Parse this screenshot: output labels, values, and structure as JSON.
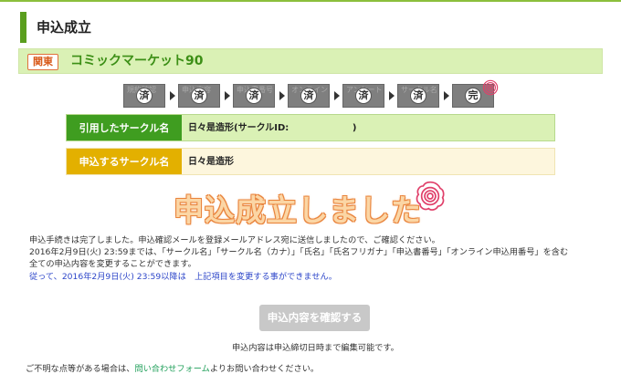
{
  "page": {
    "title": "申込成立"
  },
  "event": {
    "region": "関東",
    "name": "コミックマーケット90"
  },
  "steps": [
    {
      "bg": "規約確認",
      "seal": "済"
    },
    {
      "bg": "申込内容",
      "seal": "済"
    },
    {
      "bg": "申込書番号",
      "seal": "済"
    },
    {
      "bg": "オンライン申込",
      "seal": "済"
    },
    {
      "bg": "アンケート",
      "seal": "済"
    },
    {
      "bg": "サークル名",
      "seal": "済"
    },
    {
      "bg": "",
      "seal": "完"
    }
  ],
  "quoted_circle": {
    "label": "引用したサークル名",
    "value": "日々是造形(サークルID:                    )"
  },
  "applying_circle": {
    "label": "申込するサークル名",
    "value": "日々是造形"
  },
  "big_message": "申込成立しました",
  "messages": {
    "line1": "申込手続きは完了しました。申込確認メールを登録メールアドレス宛に送信しましたので、ご確認ください。",
    "line2": "2016年2月9日(火) 23:59までは、「サークル名」「サークル名（カナ）」「氏名」「氏名フリガナ」「申込書番号」「オンライン申込用番号」を含む",
    "line3": "全ての申込内容を変更することができます。",
    "line4": "従って、2016年2月9日(火) 23:59以降は　上記項目を変更する事ができません。"
  },
  "confirm_button": "申込内容を確認する",
  "edit_note": "申込内容は申込締切日時まで編集可能です。",
  "contact": {
    "before": "ご不明な点等がある場合は、",
    "link": "問い合わせフォーム",
    "after": "よりお問い合わせください。"
  },
  "colors": {
    "accent_green": "#3f9d20",
    "accent_yellow": "#e3b000",
    "message_orange": "#e9843d",
    "notice_blue": "#2d46c9"
  }
}
